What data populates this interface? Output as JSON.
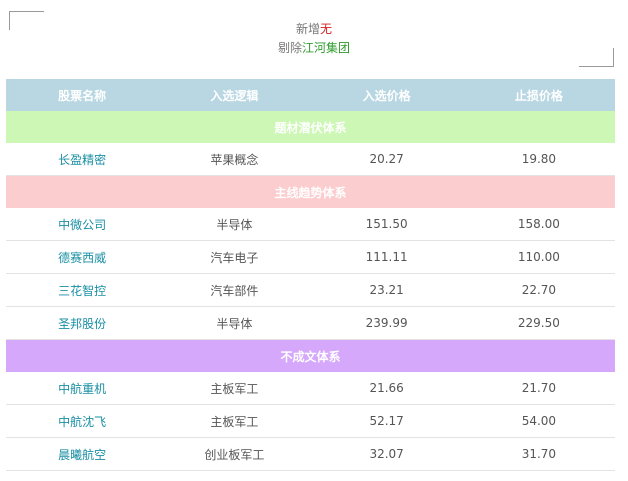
{
  "summary": {
    "added_label": "新增",
    "added_value": "无",
    "removed_label": "剔除",
    "removed_value": "江河集团"
  },
  "colors": {
    "header_bg": "#b8d7e2",
    "section_1_bg": "#ccf7b4",
    "section_2_bg": "#fccdcf",
    "section_3_bg": "#d5a8fb",
    "stock_name": "#1a8fa3",
    "added_value": "#d0201f",
    "removed_value": "#2e9b2e"
  },
  "table": {
    "headers": [
      "股票名称",
      "入选逻辑",
      "入选价格",
      "止损价格"
    ],
    "sections": [
      {
        "title": "题材潜伏体系",
        "rows": [
          {
            "name": "长盈精密",
            "logic": "苹果概念",
            "entry": "20.27",
            "stop": "19.80"
          }
        ]
      },
      {
        "title": "主线趋势体系",
        "rows": [
          {
            "name": "中微公司",
            "logic": "半导体",
            "entry": "151.50",
            "stop": "158.00"
          },
          {
            "name": "德赛西威",
            "logic": "汽车电子",
            "entry": "111.11",
            "stop": "110.00"
          },
          {
            "name": "三花智控",
            "logic": "汽车部件",
            "entry": "23.21",
            "stop": "22.70"
          },
          {
            "name": "圣邦股份",
            "logic": "半导体",
            "entry": "239.99",
            "stop": "229.50"
          }
        ]
      },
      {
        "title": "不成文体系",
        "rows": [
          {
            "name": "中航重机",
            "logic": "主板军工",
            "entry": "21.66",
            "stop": "21.70"
          },
          {
            "name": "中航沈飞",
            "logic": "主板军工",
            "entry": "52.17",
            "stop": "54.00"
          },
          {
            "name": "晨曦航空",
            "logic": "创业板军工",
            "entry": "32.07",
            "stop": "31.70"
          }
        ]
      }
    ]
  }
}
